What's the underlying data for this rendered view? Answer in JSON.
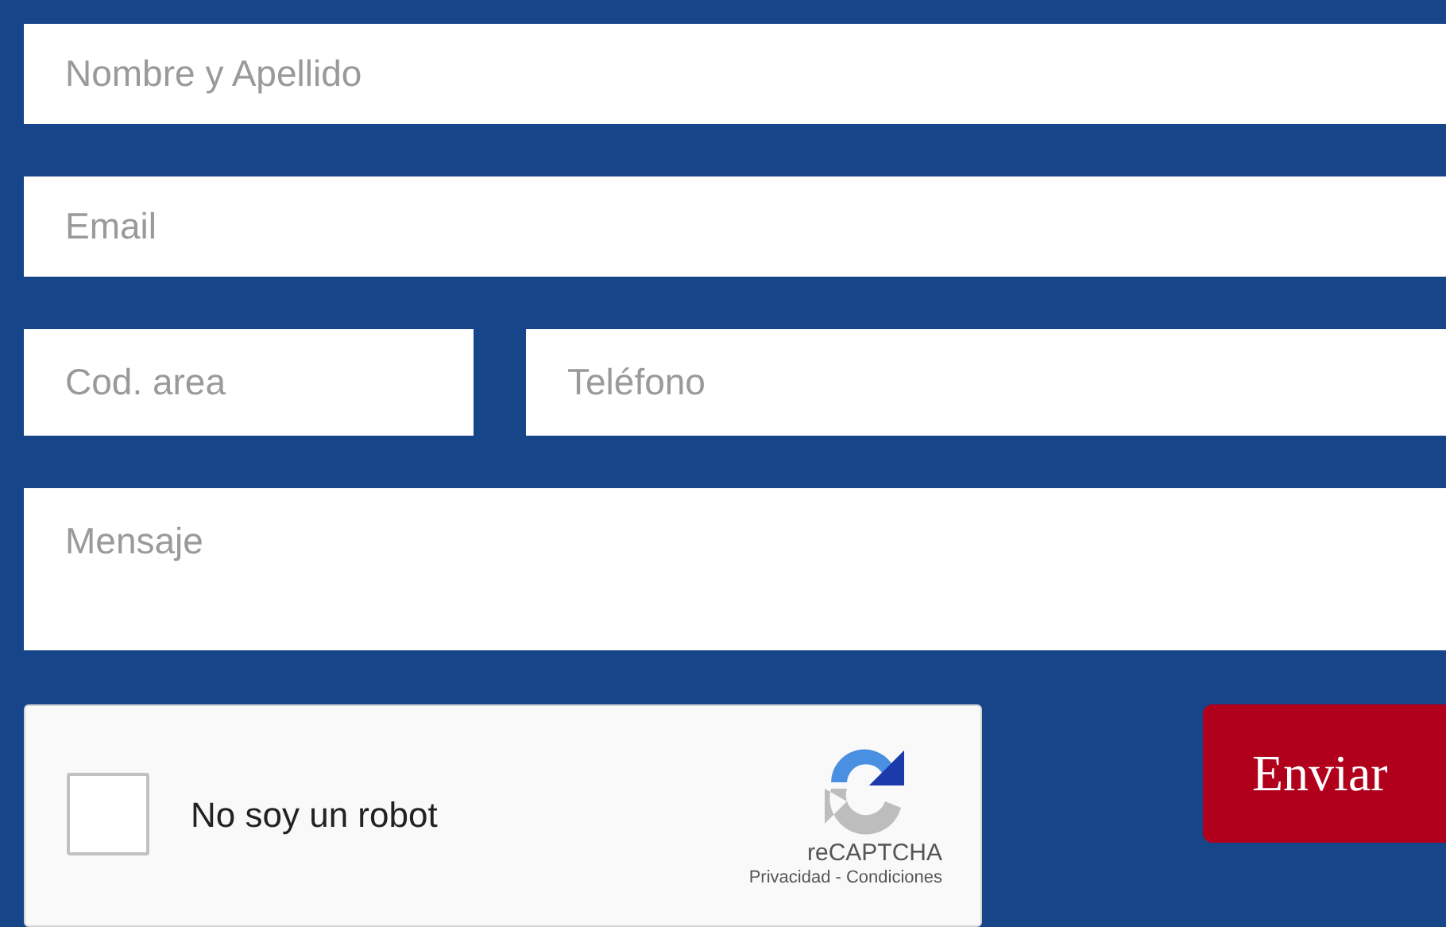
{
  "form": {
    "fields": [
      {
        "kind": "input",
        "placeholder": "Nombre y Apellido"
      },
      {
        "kind": "input",
        "placeholder": "Email"
      },
      {
        "kind": "pair",
        "placeholder": "Cod. area",
        "second_placeholder": "Teléfono"
      },
      {
        "kind": "textarea",
        "placeholder": "Mensaje"
      }
    ],
    "captcha": {
      "label": "No soy un robot",
      "checked": false,
      "brand": "reCAPTCHA",
      "links": "Privacidad - Condiciones"
    },
    "submit": "Enviar"
  }
}
